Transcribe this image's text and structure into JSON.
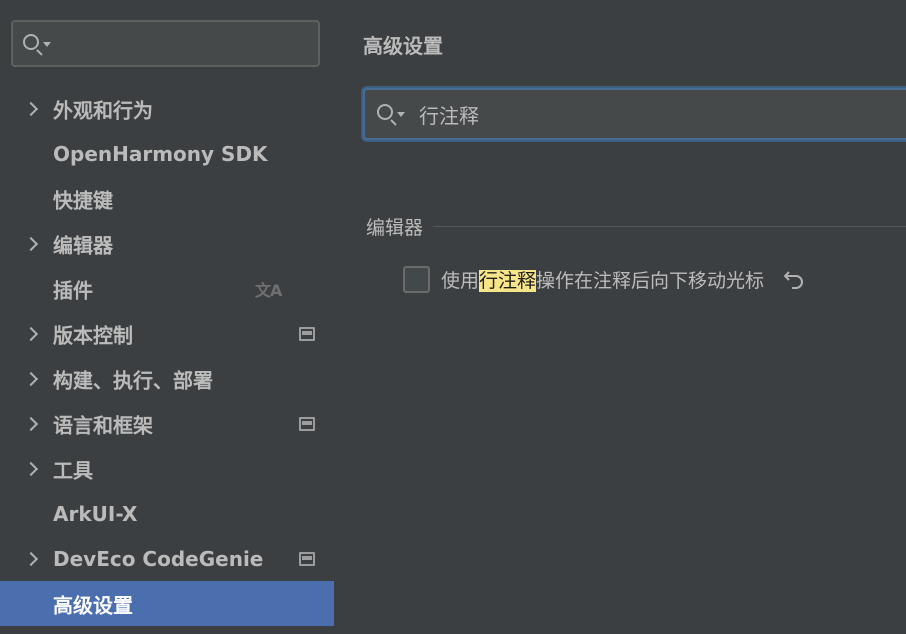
{
  "sidebar": {
    "search": {
      "value": "",
      "placeholder": ""
    },
    "items": [
      {
        "label": "外观和行为",
        "expandable": true
      },
      {
        "label": "OpenHarmony SDK",
        "expandable": false
      },
      {
        "label": "快捷键",
        "expandable": false
      },
      {
        "label": "编辑器",
        "expandable": true
      },
      {
        "label": "插件",
        "expandable": false,
        "icon": "translate-icon"
      },
      {
        "label": "版本控制",
        "expandable": true,
        "icon": "project-settings-icon"
      },
      {
        "label": "构建、执行、部署",
        "expandable": true
      },
      {
        "label": "语言和框架",
        "expandable": true,
        "icon": "project-settings-icon"
      },
      {
        "label": "工具",
        "expandable": true
      },
      {
        "label": "ArkUI-X",
        "expandable": false
      },
      {
        "label": "DevEco CodeGenie",
        "expandable": true,
        "icon": "project-settings-icon"
      },
      {
        "label": "高级设置",
        "expandable": false,
        "selected": true
      }
    ]
  },
  "main": {
    "title": "高级设置",
    "search": {
      "value": "行注释"
    },
    "section": "编辑器",
    "option": {
      "checked": false,
      "text_before": "使用",
      "text_highlight": "行注释",
      "text_after": "操作在注释后向下移动光标"
    }
  },
  "colors": {
    "background": "#3c3f41",
    "selected": "#4b6eaf",
    "highlight": "#f9e589",
    "focus_border": "#466d94"
  }
}
